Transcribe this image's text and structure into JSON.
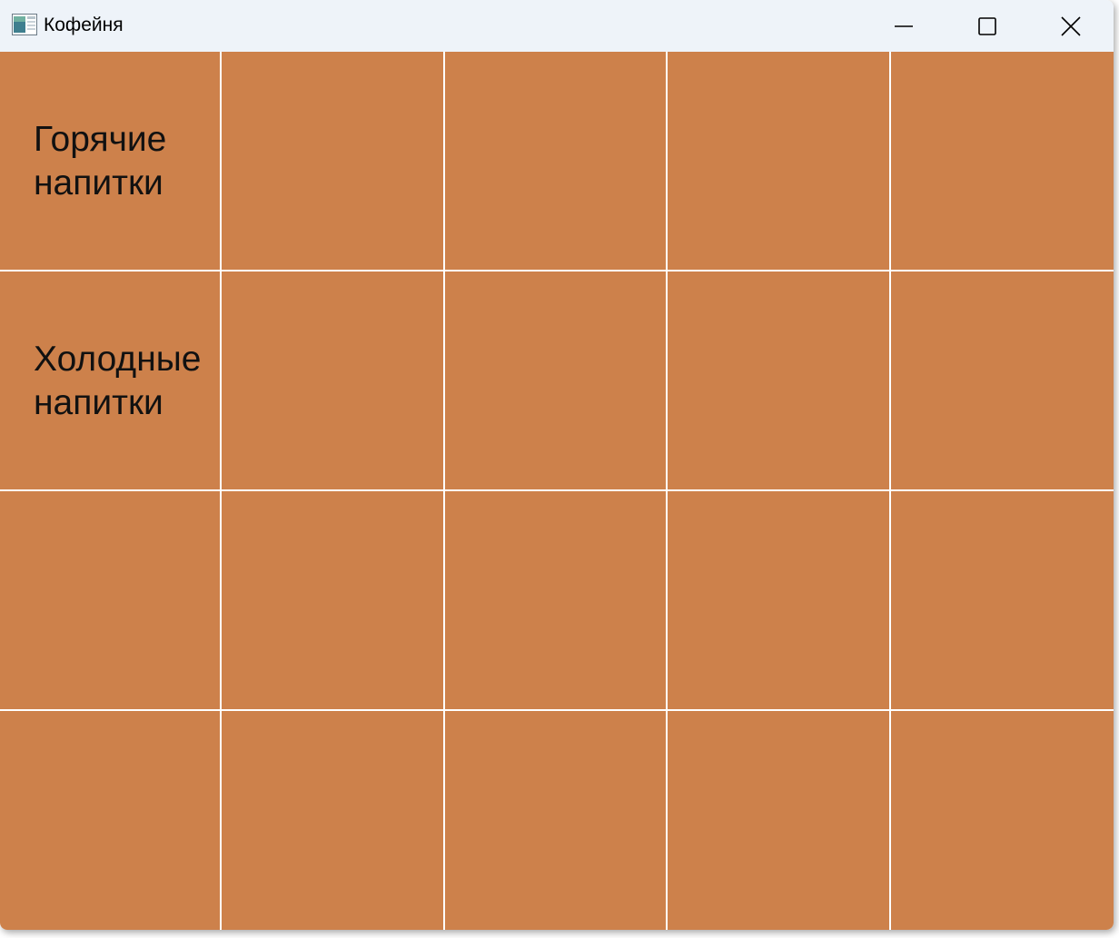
{
  "window": {
    "title": "Кофейня"
  },
  "icons": {
    "app": "app-window-icon",
    "minimize": "minimize-icon",
    "maximize": "maximize-icon",
    "close": "close-icon"
  },
  "colors": {
    "cell_background": "#cd814b",
    "grid_lines": "#ffffff",
    "titlebar": "#eef3f9"
  },
  "menu": {
    "hot_drinks": "Горячие\nнапитки",
    "cold_drinks": "Холодные\nнапитки"
  }
}
